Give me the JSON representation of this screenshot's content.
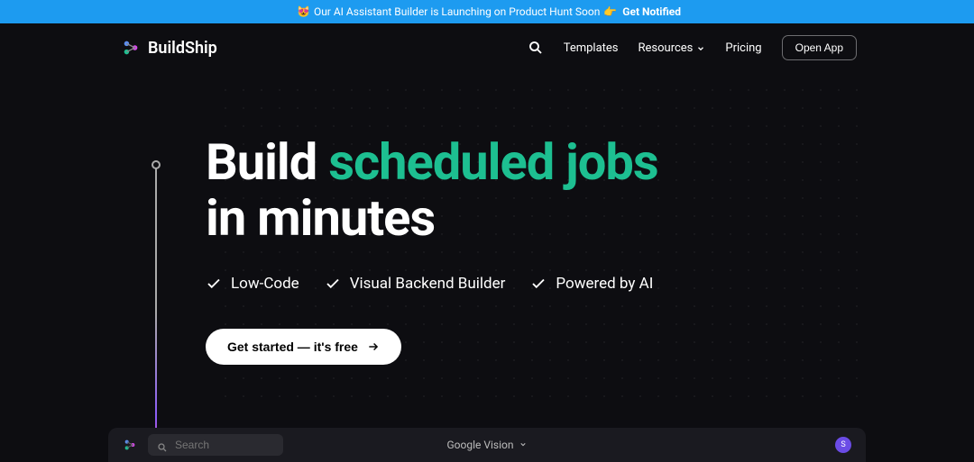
{
  "announcement": {
    "emoji1": "😻",
    "text": "Our AI Assistant Builder is Launching on Product Hunt Soon",
    "emoji2": "👉",
    "cta": "Get Notified"
  },
  "brand": {
    "name": "BuildShip"
  },
  "nav": {
    "templates": "Templates",
    "resources": "Resources",
    "pricing": "Pricing",
    "open_app": "Open App"
  },
  "hero": {
    "title_prefix": "Build",
    "title_accent": "scheduled jobs",
    "title_suffix": "in minutes"
  },
  "features": {
    "f1": "Low-Code",
    "f2": "Visual Backend Builder",
    "f3": "Powered by AI"
  },
  "cta": {
    "label": "Get started — it's free"
  },
  "bottombar": {
    "search_placeholder": "Search",
    "center_label": "Google Vision",
    "avatar_initial": "S"
  }
}
